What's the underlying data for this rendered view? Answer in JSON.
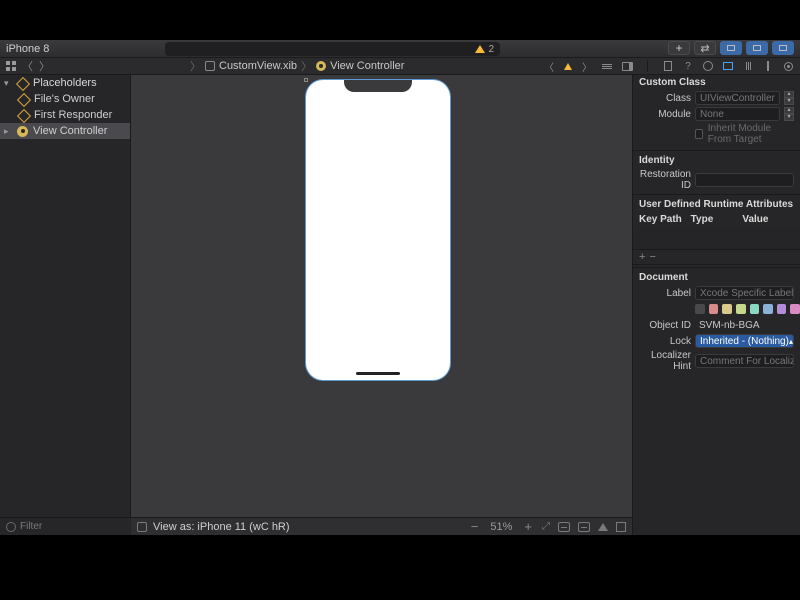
{
  "toolbar": {
    "device": "iPhone 8",
    "warning_count": "2"
  },
  "breadcrumb": {
    "file": "CustomView.xib",
    "item": "View Controller"
  },
  "navigator": {
    "filter_placeholder": "Filter",
    "groups": [
      {
        "label": "Placeholders"
      }
    ],
    "items": [
      {
        "label": "File's Owner"
      },
      {
        "label": "First Responder"
      }
    ],
    "selected": {
      "label": "View Controller"
    }
  },
  "canvas": {
    "view_as": "View as: iPhone 11 (wC hR)",
    "zoom": "51%"
  },
  "inspector": {
    "custom_class": {
      "header": "Custom Class",
      "class_label": "Class",
      "class_value": "UIViewController",
      "module_label": "Module",
      "module_value": "None",
      "inherit_label": "Inherit Module From Target"
    },
    "identity": {
      "header": "Identity",
      "restoration_label": "Restoration ID"
    },
    "runtime": {
      "header": "User Defined Runtime Attributes",
      "col_keypath": "Key Path",
      "col_type": "Type",
      "col_value": "Value"
    },
    "document": {
      "header": "Document",
      "label_label": "Label",
      "label_placeholder": "Xcode Specific Label",
      "object_id_label": "Object ID",
      "object_id_value": "SVM-nb-BGA",
      "lock_label": "Lock",
      "lock_value": "Inherited - (Nothing)",
      "loc_hint_label": "Localizer Hint",
      "loc_hint_placeholder": "Comment For Localizer"
    }
  }
}
